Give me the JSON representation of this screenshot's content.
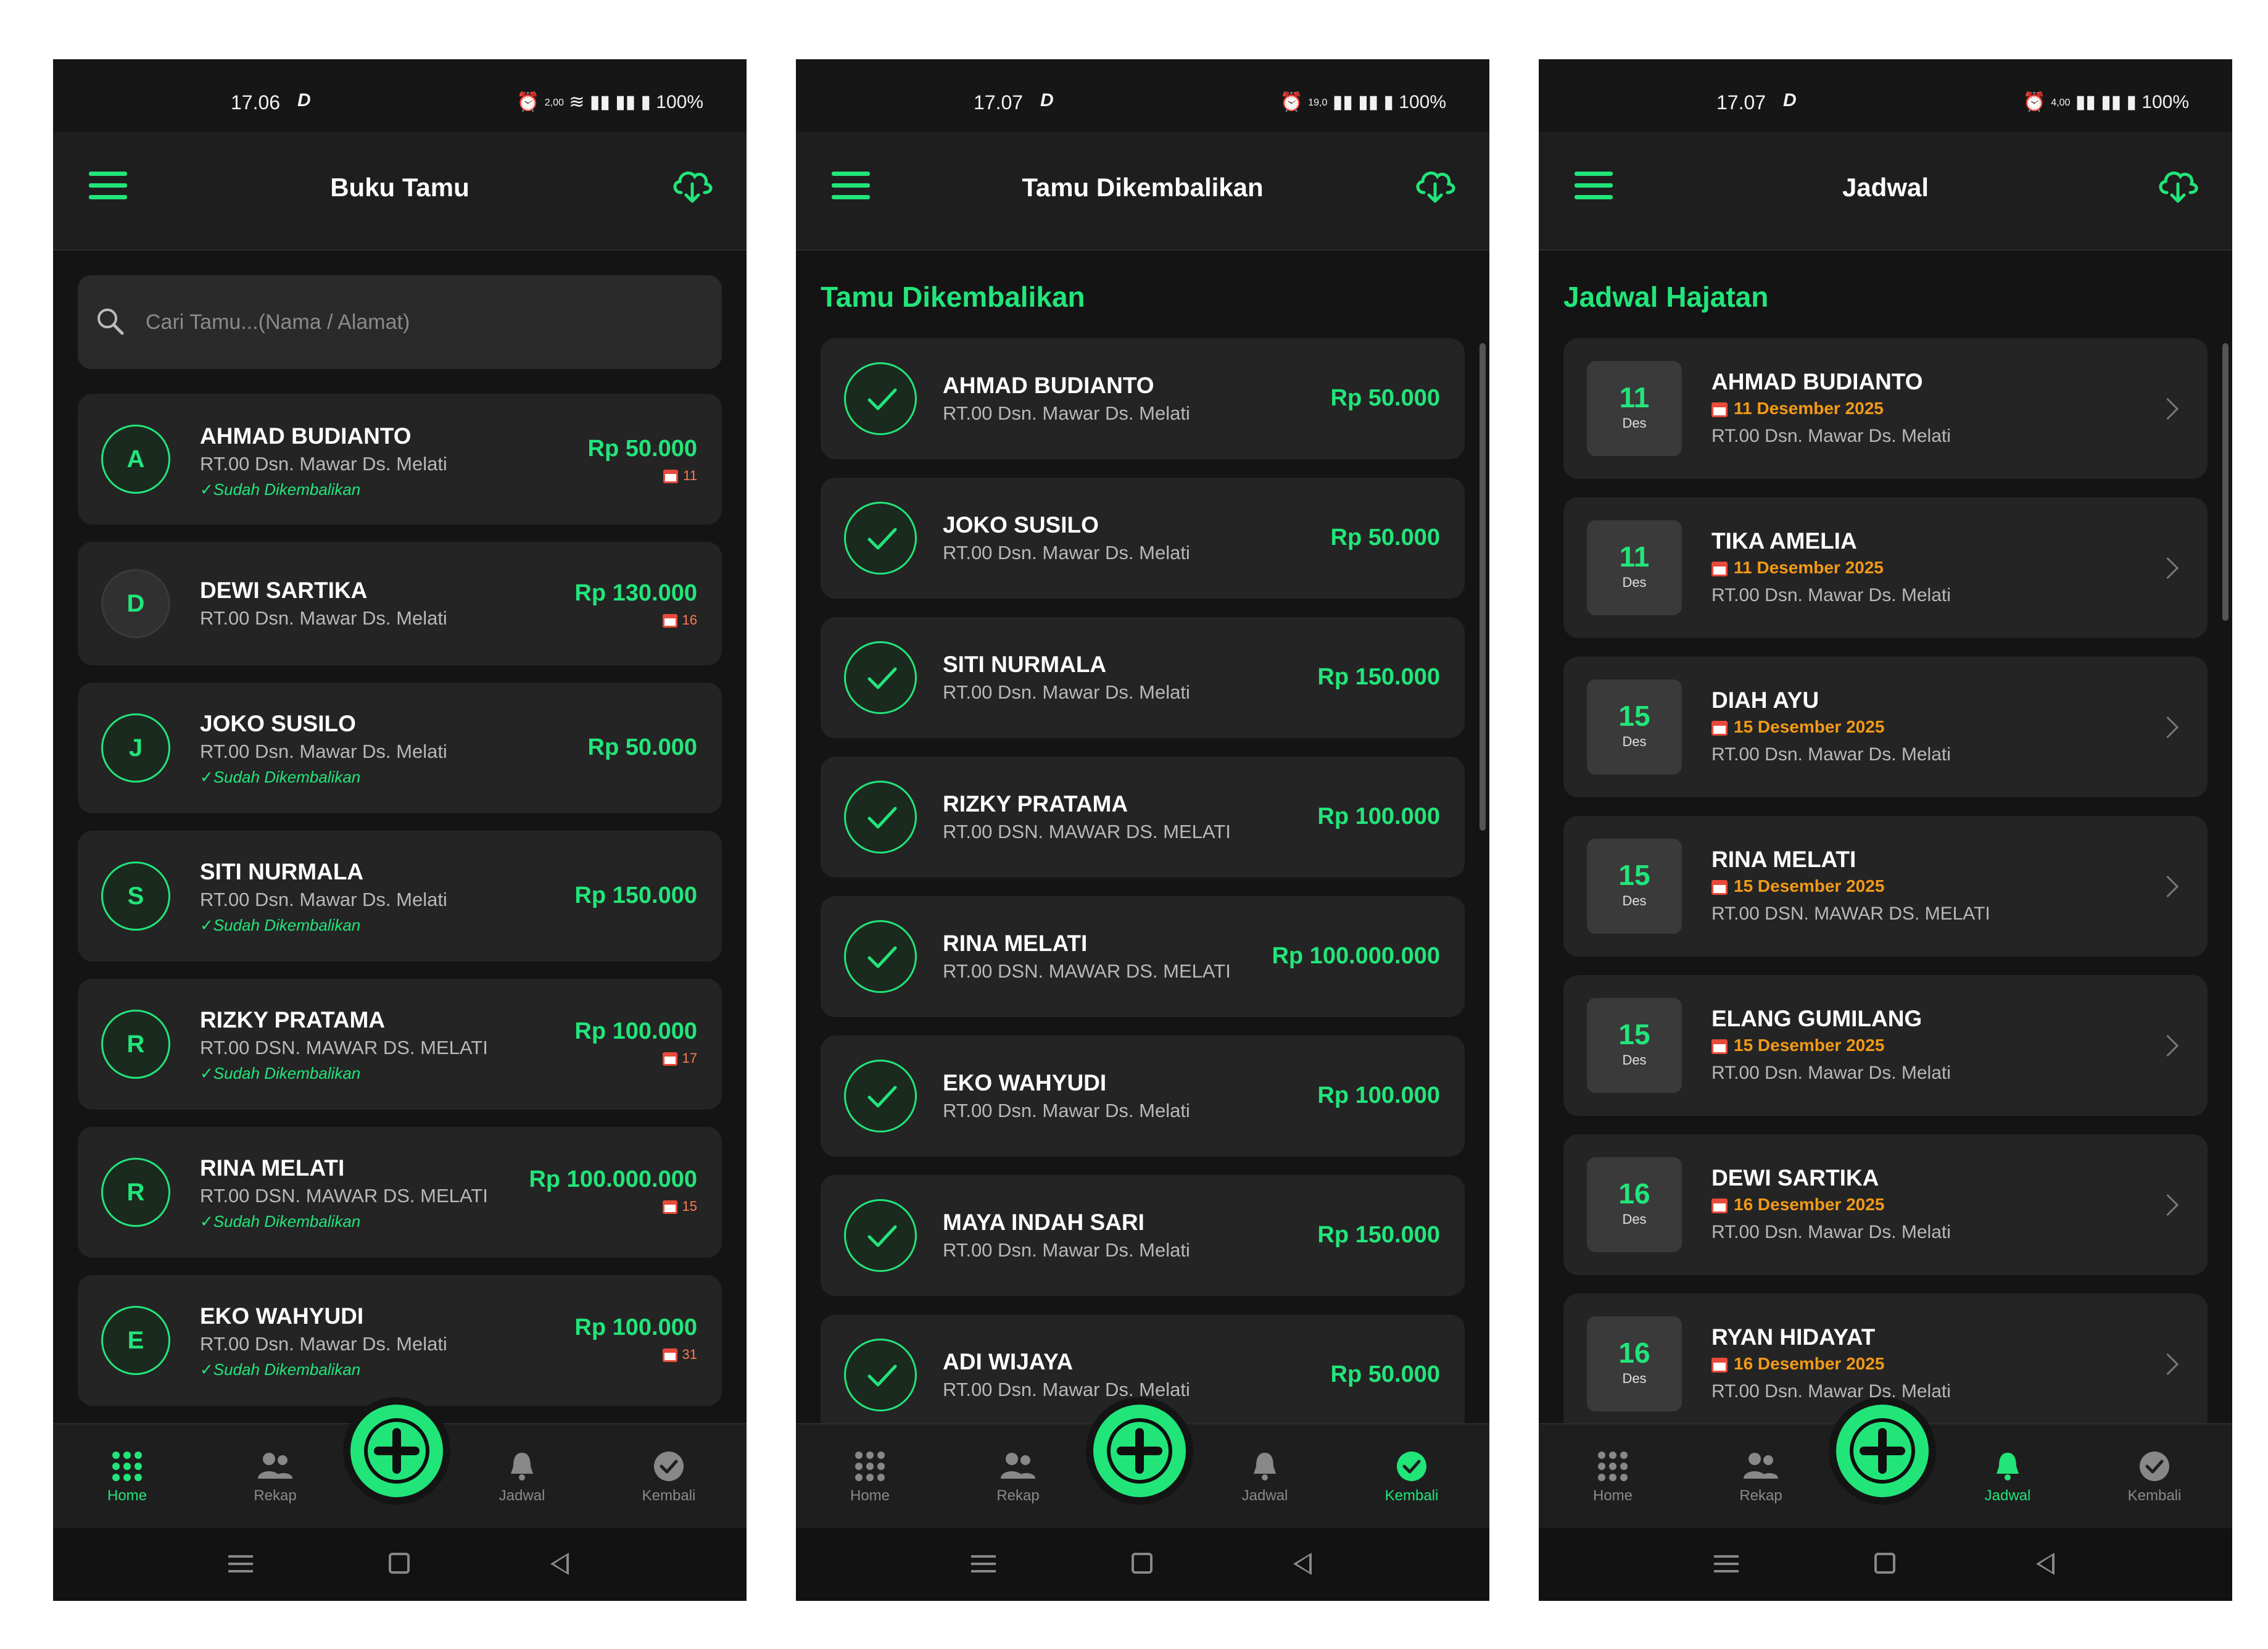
{
  "screens": [
    {
      "status": {
        "time": "17.06",
        "net": "2,00",
        "battery": "100%"
      },
      "title": "Buku Tamu",
      "search": {
        "placeholder": "Cari Tamu...(Nama / Alamat)"
      },
      "guests": [
        {
          "initial": "A",
          "name": "AHMAD BUDIANTO",
          "address": "RT.00 Dsn. Mawar Ds. Melati",
          "returned": "✓Sudah Dikembalikan",
          "amount": "Rp 50.000",
          "date": "11"
        },
        {
          "initial": "D",
          "name": "DEWI SARTIKA",
          "address": "RT.00 Dsn. Mawar Ds. Melati",
          "returned": "",
          "amount": "Rp 130.000",
          "date": "16"
        },
        {
          "initial": "J",
          "name": "JOKO SUSILO",
          "address": "RT.00 Dsn. Mawar Ds. Melati",
          "returned": "✓Sudah Dikembalikan",
          "amount": "Rp 50.000",
          "date": ""
        },
        {
          "initial": "S",
          "name": "SITI NURMALA",
          "address": "RT.00 Dsn. Mawar Ds. Melati",
          "returned": "✓Sudah Dikembalikan",
          "amount": "Rp 150.000",
          "date": ""
        },
        {
          "initial": "R",
          "name": "RIZKY PRATAMA",
          "address": "RT.00 DSN. MAWAR DS. MELATI",
          "returned": "✓Sudah Dikembalikan",
          "amount": "Rp 100.000",
          "date": "17"
        },
        {
          "initial": "R",
          "name": "RINA MELATI",
          "address": "RT.00 DSN. MAWAR DS. MELATI",
          "returned": "✓Sudah Dikembalikan",
          "amount": "Rp 100.000.000",
          "date": "15"
        },
        {
          "initial": "E",
          "name": "EKO WAHYUDI",
          "address": "RT.00 Dsn. Mawar Ds. Melati",
          "returned": "✓Sudah Dikembalikan",
          "amount": "Rp 100.000",
          "date": "31"
        }
      ]
    },
    {
      "status": {
        "time": "17.07",
        "net": "19,0",
        "battery": "100%"
      },
      "title": "Tamu Dikembalikan",
      "section": "Tamu Dikembalikan",
      "returned": [
        {
          "name": "AHMAD BUDIANTO",
          "address": "RT.00 Dsn. Mawar Ds. Melati",
          "amount": "Rp 50.000"
        },
        {
          "name": "JOKO SUSILO",
          "address": "RT.00 Dsn. Mawar Ds. Melati",
          "amount": "Rp 50.000"
        },
        {
          "name": "SITI NURMALA",
          "address": "RT.00 Dsn. Mawar Ds. Melati",
          "amount": "Rp 150.000"
        },
        {
          "name": "RIZKY PRATAMA",
          "address": "RT.00 DSN. MAWAR DS. MELATI",
          "amount": "Rp 100.000"
        },
        {
          "name": "RINA MELATI",
          "address": "RT.00 DSN. MAWAR DS. MELATI",
          "amount": "Rp 100.000.000"
        },
        {
          "name": "EKO WAHYUDI",
          "address": "RT.00 Dsn. Mawar Ds. Melati",
          "amount": "Rp 100.000"
        },
        {
          "name": "MAYA INDAH SARI",
          "address": "RT.00 Dsn. Mawar Ds. Melati",
          "amount": "Rp 150.000"
        },
        {
          "name": "ADI WIJAYA",
          "address": "RT.00 Dsn. Mawar Ds. Melati",
          "amount": "Rp 50.000"
        }
      ]
    },
    {
      "status": {
        "time": "17.07",
        "net": "4,00",
        "battery": "100%"
      },
      "title": "Jadwal",
      "section": "Jadwal Hajatan",
      "schedule": [
        {
          "day": "11",
          "month": "Des",
          "name": "AHMAD BUDIANTO",
          "date": "11 Desember 2025",
          "address": "RT.00 Dsn. Mawar Ds. Melati"
        },
        {
          "day": "11",
          "month": "Des",
          "name": "TIKA AMELIA",
          "date": "11 Desember 2025",
          "address": "RT.00 Dsn. Mawar Ds. Melati"
        },
        {
          "day": "15",
          "month": "Des",
          "name": "DIAH AYU",
          "date": "15 Desember 2025",
          "address": "RT.00 Dsn. Mawar Ds. Melati"
        },
        {
          "day": "15",
          "month": "Des",
          "name": "RINA MELATI",
          "date": "15 Desember 2025",
          "address": "RT.00 DSN. MAWAR DS. MELATI"
        },
        {
          "day": "15",
          "month": "Des",
          "name": "ELANG GUMILANG",
          "date": "15 Desember 2025",
          "address": "RT.00 Dsn. Mawar Ds. Melati"
        },
        {
          "day": "16",
          "month": "Des",
          "name": "DEWI SARTIKA",
          "date": "16 Desember 2025",
          "address": "RT.00 Dsn. Mawar Ds. Melati"
        },
        {
          "day": "16",
          "month": "Des",
          "name": "RYAN HIDAYAT",
          "date": "16 Desember 2025",
          "address": "RT.00 Dsn. Mawar Ds. Melati"
        }
      ]
    }
  ],
  "nav": {
    "home": "Home",
    "rekap": "Rekap",
    "jadwal": "Jadwal",
    "kembali": "Kembali"
  },
  "colors": {
    "accent": "#22e57a",
    "background": "#141414",
    "card": "#242424",
    "date_orange": "#f29a17"
  }
}
